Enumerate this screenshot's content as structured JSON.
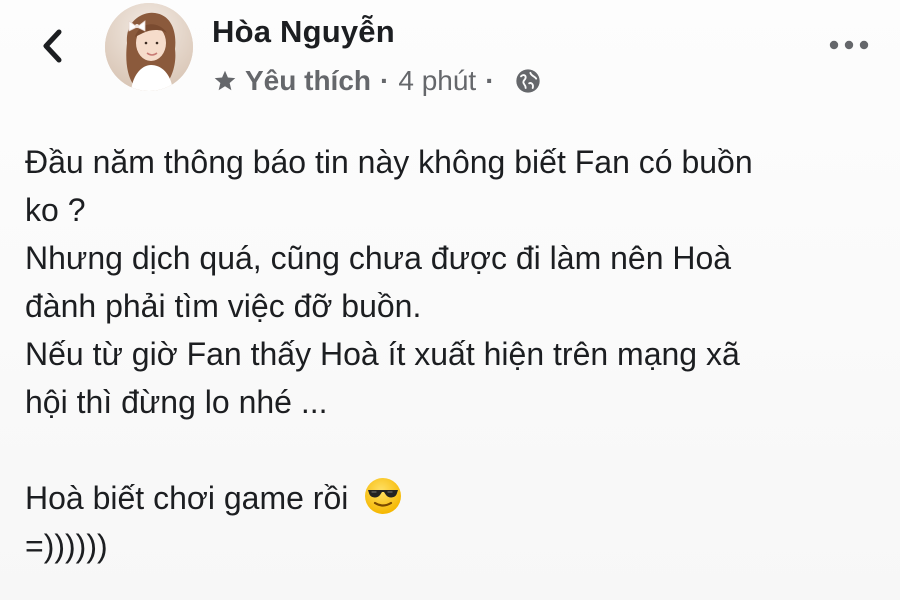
{
  "header": {
    "back_icon": "chevron-left-icon",
    "author_name": "Hòa Nguyễn",
    "meta": {
      "star_icon": "star-icon",
      "audience_label": "Yêu thích",
      "separator": "·",
      "time": "4 phút",
      "privacy_icon": "globe-icon"
    },
    "more_icon": "more-horizontal-icon"
  },
  "post": {
    "lines": [
      "Đầu năm thông báo tin này không biết Fan có buồn",
      "ko ?",
      "Nhưng dịch quá, cũng chưa được đi làm nên Hoà",
      "đành phải tìm việc đỡ buồn.",
      "Nếu từ giờ Fan thấy Hoà ít xuất hiện trên mạng xã",
      "hội thì đừng lo nhé ..."
    ],
    "closing_line": "Hoà biết chơi game rồi",
    "closing_emoji": "sunglasses-emoji",
    "last_line": "=))))))"
  },
  "colors": {
    "text": "#1c1e21",
    "meta_text": "#65676b",
    "background": "#fbfbfb"
  }
}
